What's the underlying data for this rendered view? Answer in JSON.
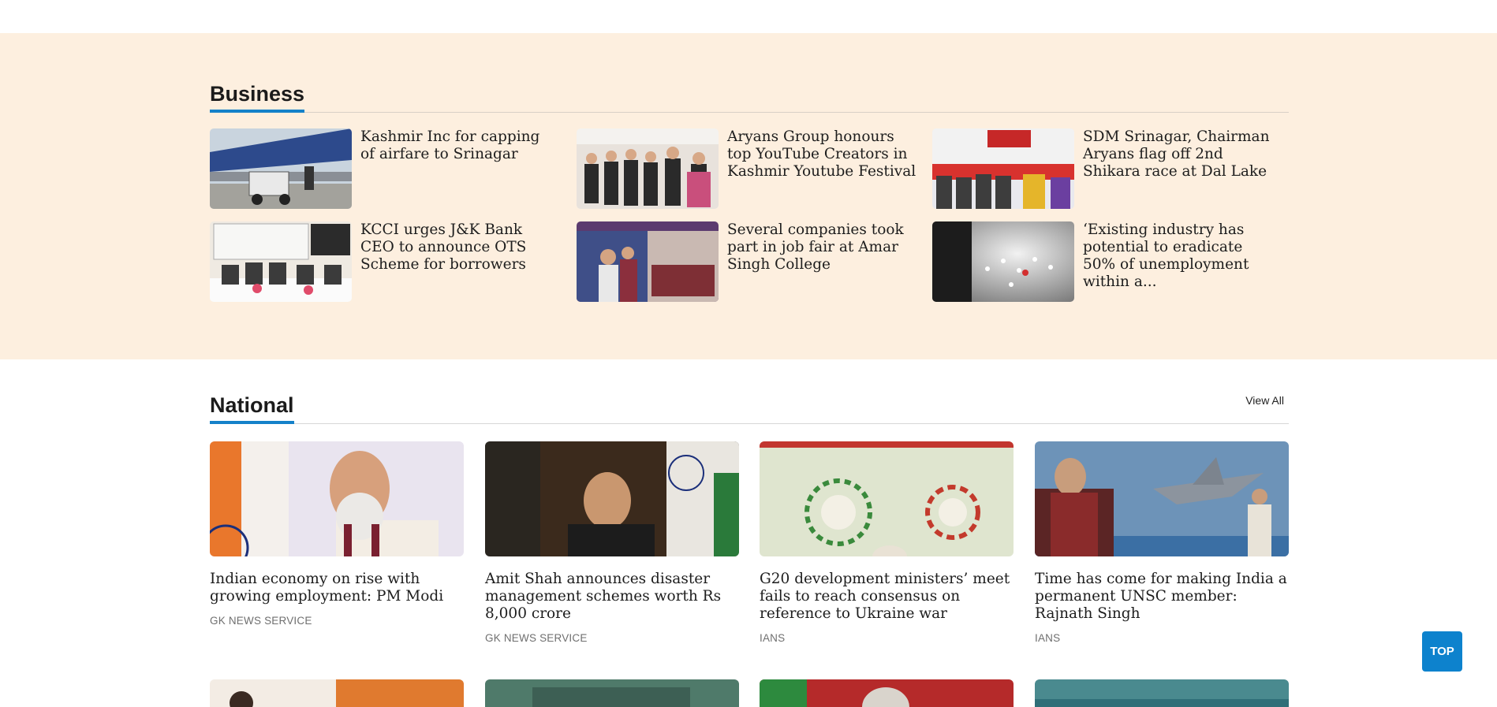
{
  "business": {
    "title": "Business",
    "items": [
      {
        "title": "Kashmir Inc for capping of airfare to Srinagar"
      },
      {
        "title": "Aryans Group honours top YouTube Creators in Kashmir Youtube Festival"
      },
      {
        "title": "SDM Srinagar, Chairman Aryans flag off 2nd Shikara race at Dal Lake"
      },
      {
        "title": "KCCI urges J&K Bank CEO to announce OTS Scheme for borrowers"
      },
      {
        "title": "Several companies took part in job fair at Amar Singh College"
      },
      {
        "title": "‘Existing industry has potential to eradicate 50% of unemployment within a..."
      }
    ]
  },
  "national": {
    "title": "National",
    "view_all": "View All",
    "cards": [
      {
        "title": "Indian economy on rise with growing employment: PM Modi",
        "source": "GK NEWS SERVICE"
      },
      {
        "title": "Amit Shah announces disaster management schemes worth Rs 8,000 crore",
        "source": "GK NEWS SERVICE"
      },
      {
        "title": "G20 development ministers’ meet fails to reach consensus on reference to Ukraine war",
        "source": "IANS"
      },
      {
        "title": "Time has come for making India a permanent UNSC member: Rajnath Singh",
        "source": "IANS"
      }
    ]
  },
  "top_button": "TOP",
  "colors": {
    "accent": "#1581c9",
    "business_bg": "#fdefdf",
    "top_button_bg": "#0d82cd"
  }
}
